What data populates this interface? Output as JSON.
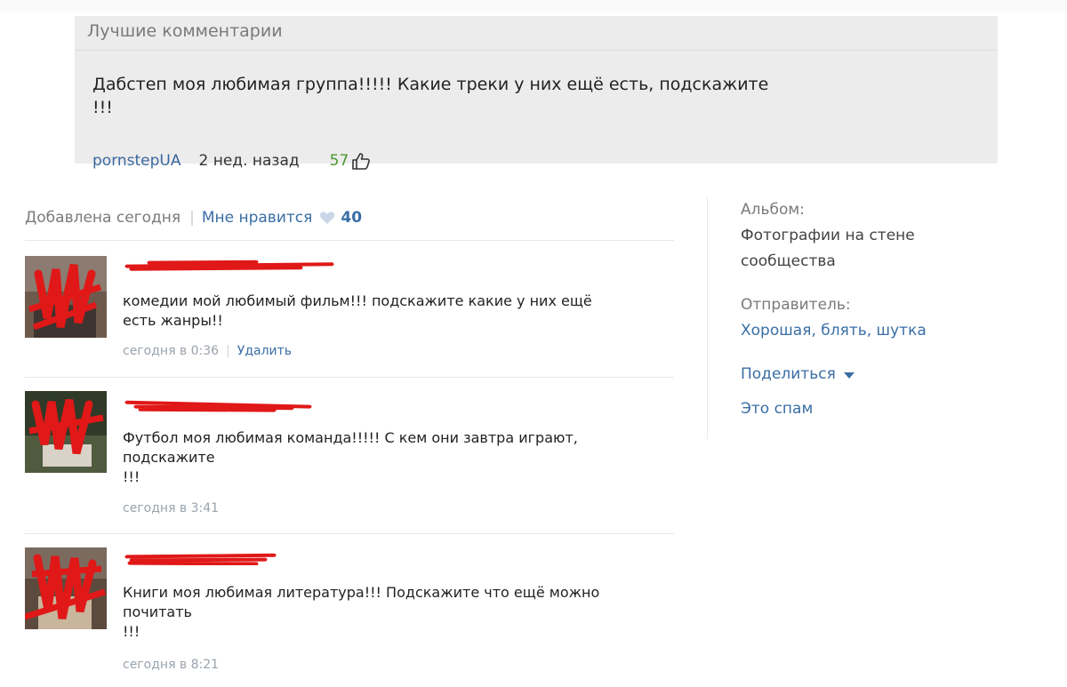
{
  "best_comments": {
    "header": "Лучшие комментарии",
    "text_line1": "Дабстеп моя любимая группа!!!!! Какие треки у них ещё есть, подскажите",
    "text_line2": "!!!",
    "author": "pornstepUA",
    "time": "2 нед. назад",
    "likes": "57"
  },
  "photo_info": {
    "added": "Добавлена сегодня",
    "separator": "|",
    "like_label": "Мне нравится",
    "like_count": "40"
  },
  "comments": [
    {
      "text_line1": "комедии мой любимый фильм!!! подскажите какие у них ещё",
      "text_line2": "есть жанры!!",
      "text_line3": "",
      "time": "сегодня в 0:36",
      "delete_label": "Удалить"
    },
    {
      "text_line1": "Футбол моя любимая команда!!!!! С кем они завтра играют,",
      "text_line2": "подскажите",
      "text_line3": "!!!",
      "time": "сегодня в 3:41",
      "delete_label": ""
    },
    {
      "text_line1": "Книги моя любимая литература!!! Подскажите что ещё можно",
      "text_line2": "почитать",
      "text_line3": "!!!",
      "time": "сегодня в 8:21",
      "delete_label": ""
    }
  ],
  "sidebar": {
    "album_label": "Альбом:",
    "album_name_line1": "Фотографии на стене",
    "album_name_line2": "сообщества",
    "sender_label": "Отправитель:",
    "sender_name": "Хорошая, блять, шутка",
    "share_label": "Поделиться",
    "spam_label": "Это спам"
  },
  "colors": {
    "link": "#3a6ea5",
    "likes_green": "#4b9a2f",
    "scribble_red": "#e01818",
    "best_bg": "#ececec"
  },
  "icons": [
    "thumbs-up-icon",
    "heart-icon",
    "dropdown-arrow-icon"
  ]
}
